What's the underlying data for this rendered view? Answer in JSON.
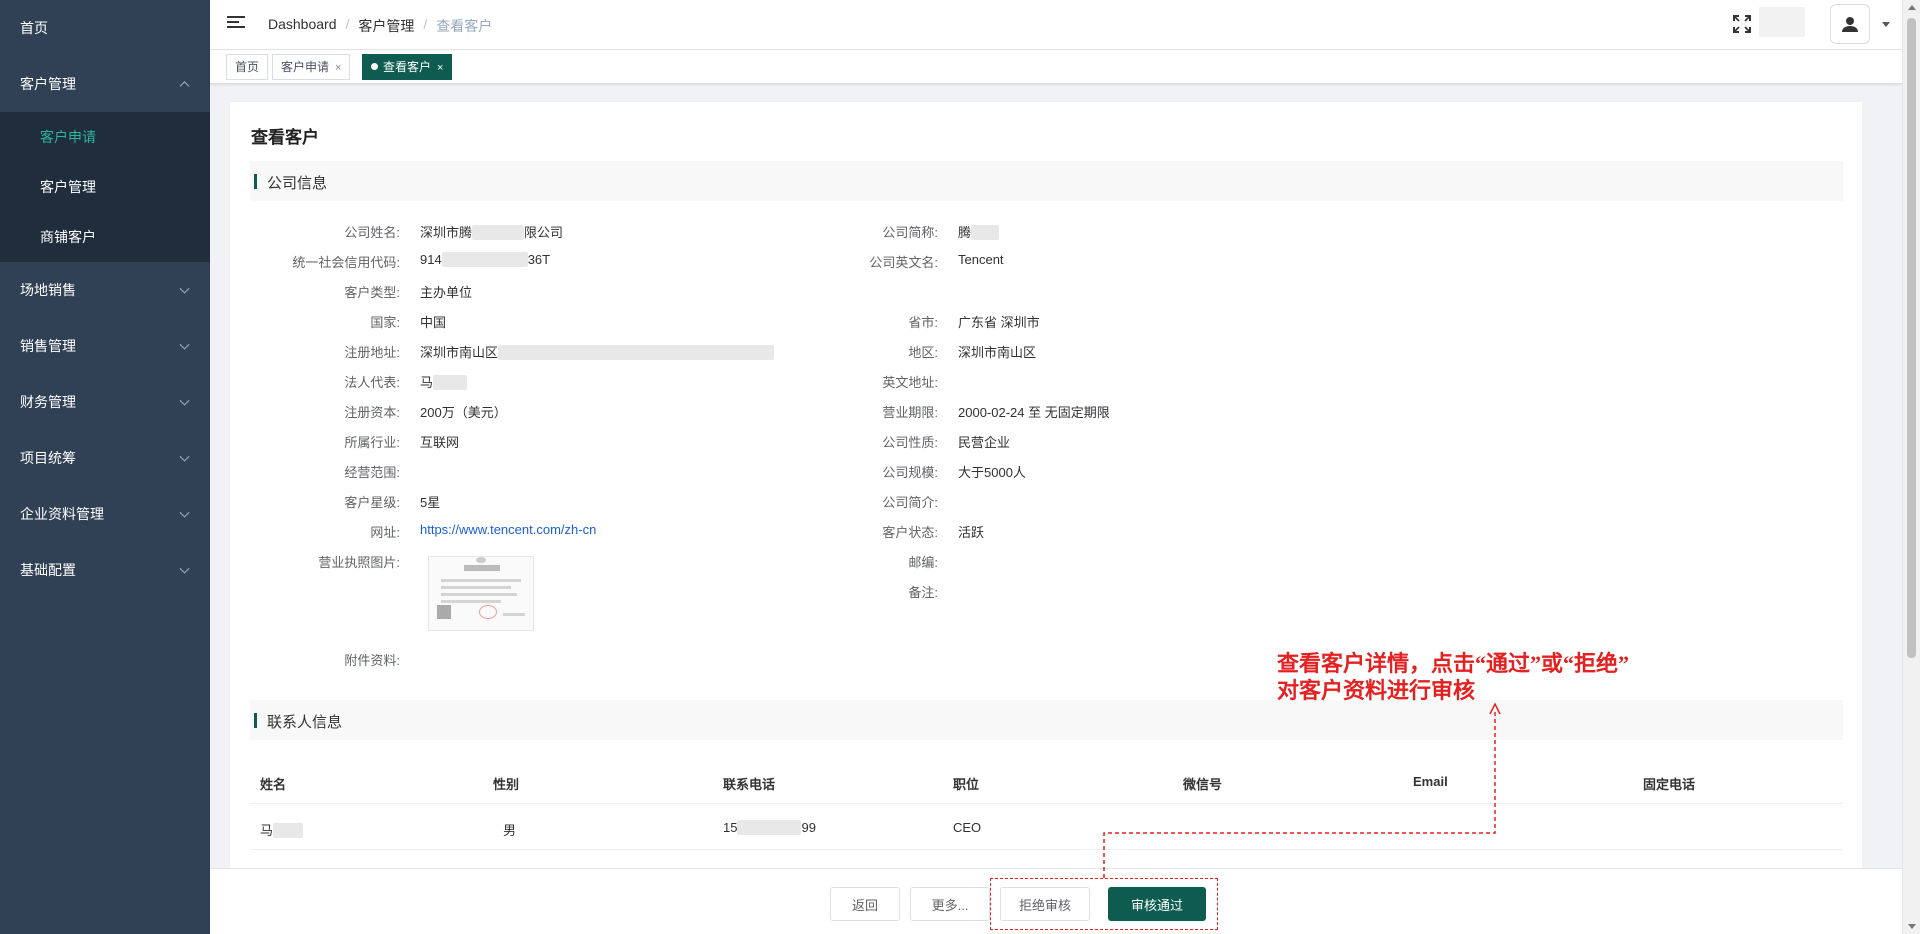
{
  "sidebar": {
    "items": [
      {
        "label": "首页"
      },
      {
        "label": "客户管理",
        "children": [
          "客户申请",
          "客户管理",
          "商铺客户"
        ]
      },
      {
        "label": "场地销售"
      },
      {
        "label": "销售管理"
      },
      {
        "label": "财务管理"
      },
      {
        "label": "项目统筹"
      },
      {
        "label": "企业资料管理"
      },
      {
        "label": "基础配置"
      }
    ]
  },
  "header": {
    "breadcrumb": [
      "Dashboard",
      "客户管理",
      "查看客户"
    ],
    "separator": "/"
  },
  "tags": [
    {
      "label": "首页"
    },
    {
      "label": "客户申请",
      "close": "×"
    },
    {
      "label": "查看客户",
      "close": "×",
      "active": true
    }
  ],
  "page": {
    "title": "查看客户",
    "company_section": "公司信息",
    "contact_section": "联系人信息"
  },
  "company": {
    "name_label": "公司姓名:",
    "name_prefix": "深圳市腾",
    "name_suffix": "限公司",
    "short_label": "公司简称:",
    "short_value": "腾",
    "credit_label": "统一社会信用代码:",
    "credit_prefix": "914",
    "credit_suffix": "36T",
    "english_label": "公司英文名:",
    "english_value": "Tencent",
    "type_label": "客户类型:",
    "type_value": "主办单位",
    "country_label": "国家:",
    "country_value": "中国",
    "province_label": "省市:",
    "province_value": "广东省 深圳市",
    "address_label": "注册地址:",
    "address_value": "深圳市南山区",
    "district_label": "地区:",
    "district_value": "深圳市南山区",
    "legal_label": "法人代表:",
    "legal_value": "马",
    "en_address_label": "英文地址:",
    "capital_label": "注册资本:",
    "capital_value": "200万（美元）",
    "term_label": "营业期限:",
    "term_value": "2000-02-24 至 无固定期限",
    "industry_label": "所属行业:",
    "industry_value": "互联网",
    "nature_label": "公司性质:",
    "nature_value": "民营企业",
    "scope_label": "经营范围:",
    "size_label": "公司规模:",
    "size_value": "大于5000人",
    "star_label": "客户星级:",
    "star_value": "5星",
    "intro_label": "公司简介:",
    "website_label": "网址:",
    "website_value": "https://www.tencent.com/zh-cn",
    "status_label": "客户状态:",
    "status_value": "活跃",
    "license_label": "营业执照图片:",
    "zip_label": "邮编:",
    "remark_label": "备注:",
    "attach_label": "附件资料:"
  },
  "contacts": {
    "columns": [
      "姓名",
      "性别",
      "联系电话",
      "职位",
      "微信号",
      "Email",
      "固定电话"
    ],
    "rows": [
      {
        "name": "马",
        "gender": "男",
        "phone_prefix": "15",
        "phone_suffix": "99",
        "position": "CEO",
        "wechat": "",
        "email": "",
        "tel": ""
      }
    ]
  },
  "footer": {
    "back": "返回",
    "more": "更多...",
    "reject": "拒绝审核",
    "approve": "审核通过"
  },
  "annotation": {
    "line1": "查看客户详情，点击“通过”或“拒绝”",
    "line2": "对客户资料进行审核",
    "color": "#e52020"
  },
  "colors": {
    "sidebar_bg": "#304156",
    "accent": "#0d5c4f",
    "active_submenu": "#2bb5a0"
  }
}
